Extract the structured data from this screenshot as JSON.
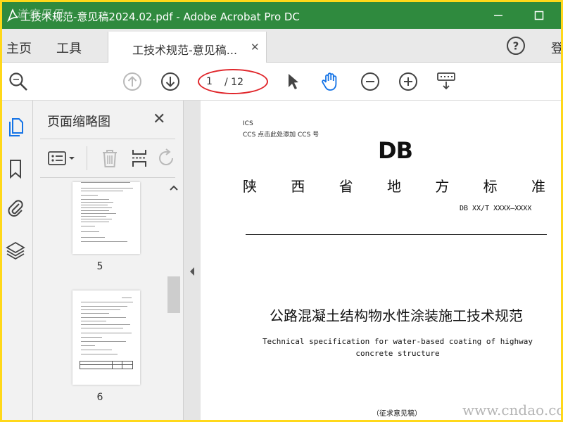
{
  "window": {
    "title": "工技术规范-意见稿2024.02.pdf - Adobe Acrobat Pro DC",
    "watermark_tl": "道客巴巴"
  },
  "tabs": {
    "home": "主页",
    "tools": "工具",
    "document_tab": "工技术规范-意见稿...",
    "signin": "登"
  },
  "toolbar": {
    "page_current": "1",
    "page_total": "/ 12"
  },
  "thumbnails": {
    "title": "页面缩略图",
    "pages": [
      {
        "number": "5"
      },
      {
        "number": "6"
      }
    ]
  },
  "document": {
    "ics": "ICS",
    "ccs": "CCS 点击此处添加 CCS 号",
    "logo": "DB",
    "standard_chars": [
      "陕",
      "西",
      "省",
      "地",
      "方",
      "标",
      "准"
    ],
    "standard_number": "DB XX/T XXXX—XXXX",
    "title_cn": "公路混凝土结构物水性涂装施工技术规范",
    "title_en": "Technical specification for water-based coating of highway concrete structure",
    "draft_label": "（征求意见稿）"
  },
  "watermark_br": "www.cndao.com",
  "colors": {
    "titlebar": "#2f8a3e",
    "highlight_oval": "#e0262b",
    "accent_blue": "#1473e6",
    "frame": "#ffd81a"
  },
  "icons": {
    "zoom": "search-icon",
    "prev_page": "arrow-up-circle-icon",
    "next_page": "arrow-down-circle-icon",
    "select": "cursor-arrow-icon",
    "hand": "hand-icon",
    "zoom_out": "minus-circle-icon",
    "zoom_in": "plus-circle-icon",
    "scroll_mode": "keyboard-down-icon"
  }
}
